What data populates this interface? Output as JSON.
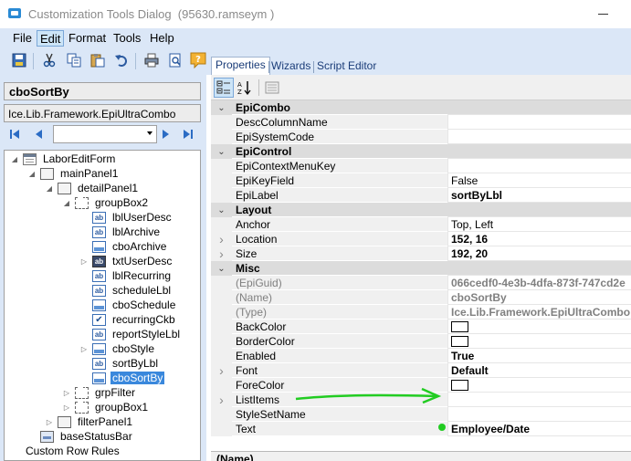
{
  "window": {
    "title": "Customization Tools Dialog",
    "user": "(95630.ramseym )"
  },
  "menu": [
    "File",
    "Edit",
    "Format",
    "Tools",
    "Help"
  ],
  "toolbar_icons": [
    "save-icon",
    "cut-icon",
    "copy-icon",
    "paste-icon",
    "undo-icon",
    "print-icon",
    "print-preview-icon",
    "help-icon"
  ],
  "left": {
    "control_name": "cboSortBy",
    "control_type": "Ice.Lib.Framework.EpiUltraCombo",
    "nav_combo_value": ""
  },
  "tree": [
    {
      "label": "LaborEditForm",
      "icon": "form-icon",
      "depth": 0,
      "expander": "open"
    },
    {
      "label": "mainPanel1",
      "icon": "panel-icon",
      "depth": 1,
      "expander": "open"
    },
    {
      "label": "detailPanel1",
      "icon": "panel-icon",
      "depth": 2,
      "expander": "open"
    },
    {
      "label": "groupBox2",
      "icon": "groupbox-icon",
      "depth": 3,
      "expander": "open"
    },
    {
      "label": "lblUserDesc",
      "icon": "label-icon",
      "depth": 4,
      "expander": ""
    },
    {
      "label": "lblArchive",
      "icon": "label-icon",
      "depth": 4,
      "expander": ""
    },
    {
      "label": "cboArchive",
      "icon": "combo-icon",
      "depth": 4,
      "expander": ""
    },
    {
      "label": "txtUserDesc",
      "icon": "textbox-icon",
      "depth": 4,
      "expander": "closed"
    },
    {
      "label": "lblRecurring",
      "icon": "label-icon",
      "depth": 4,
      "expander": ""
    },
    {
      "label": "scheduleLbl",
      "icon": "label-icon",
      "depth": 4,
      "expander": ""
    },
    {
      "label": "cboSchedule",
      "icon": "combo-icon",
      "depth": 4,
      "expander": ""
    },
    {
      "label": "recurringCkb",
      "icon": "checkbox-icon",
      "depth": 4,
      "expander": ""
    },
    {
      "label": "reportStyleLbl",
      "icon": "label-icon",
      "depth": 4,
      "expander": ""
    },
    {
      "label": "cboStyle",
      "icon": "combo-icon",
      "depth": 4,
      "expander": "closed"
    },
    {
      "label": "sortByLbl",
      "icon": "label-icon",
      "depth": 4,
      "expander": ""
    },
    {
      "label": "cboSortBy",
      "icon": "combo-icon",
      "depth": 4,
      "expander": "",
      "selected": true
    },
    {
      "label": "grpFilter",
      "icon": "groupbox-icon",
      "depth": 3,
      "expander": "closed"
    },
    {
      "label": "groupBox1",
      "icon": "groupbox-icon",
      "depth": 3,
      "expander": "closed"
    },
    {
      "label": "filterPanel1",
      "icon": "panel-icon",
      "depth": 2,
      "expander": "closed"
    },
    {
      "label": "baseStatusBar",
      "icon": "statusbar-icon",
      "depth": 1,
      "expander": ""
    },
    {
      "label": "Custom Row Rules",
      "icon": "",
      "depth": 0,
      "expander": ""
    }
  ],
  "tabs": [
    "Properties",
    "Wizards",
    "Script Editor"
  ],
  "properties": [
    {
      "kind": "category",
      "name": "EpiCombo",
      "expander": "collapse"
    },
    {
      "kind": "prop",
      "name": "DescColumnName",
      "value": ""
    },
    {
      "kind": "prop",
      "name": "EpiSystemCode",
      "value": ""
    },
    {
      "kind": "category",
      "name": "EpiControl",
      "expander": "collapse"
    },
    {
      "kind": "prop",
      "name": "EpiContextMenuKey",
      "value": ""
    },
    {
      "kind": "prop",
      "name": "EpiKeyField",
      "value": "False"
    },
    {
      "kind": "prop",
      "name": "EpiLabel",
      "value": "sortByLbl",
      "bold": true
    },
    {
      "kind": "category",
      "name": "Layout",
      "expander": "collapse"
    },
    {
      "kind": "prop",
      "name": "Anchor",
      "value": "Top, Left"
    },
    {
      "kind": "prop",
      "name": "Location",
      "value": "152, 16",
      "bold": true,
      "expander": "expand"
    },
    {
      "kind": "prop",
      "name": "Size",
      "value": "192, 20",
      "bold": true,
      "expander": "expand"
    },
    {
      "kind": "category",
      "name": "Misc",
      "expander": "collapse"
    },
    {
      "kind": "prop",
      "name": "(EpiGuid)",
      "value": "066cedf0-4e3b-4dfa-873f-747cd2e",
      "gray": true
    },
    {
      "kind": "prop",
      "name": "(Name)",
      "value": "cboSortBy",
      "gray": true
    },
    {
      "kind": "prop",
      "name": "(Type)",
      "value": "Ice.Lib.Framework.EpiUltraCombo",
      "gray": true
    },
    {
      "kind": "prop",
      "name": "BackColor",
      "value": "",
      "color_swatch": true
    },
    {
      "kind": "prop",
      "name": "BorderColor",
      "value": "",
      "color_swatch": true
    },
    {
      "kind": "prop",
      "name": "Enabled",
      "value": "True",
      "bold": true
    },
    {
      "kind": "prop",
      "name": "Font",
      "value": "Default",
      "bold": true,
      "expander": "expand"
    },
    {
      "kind": "prop",
      "name": "ForeColor",
      "value": "",
      "color_swatch": true
    },
    {
      "kind": "prop",
      "name": "ListItems",
      "value": "",
      "expander": "expand"
    },
    {
      "kind": "prop",
      "name": "StyleSetName",
      "value": ""
    },
    {
      "kind": "prop",
      "name": "Text",
      "value": "Employee/Date",
      "bold": true
    }
  ],
  "description_title": "(Name)",
  "colors": {
    "chrome": "#dbe7f7",
    "selection": "#3a88dc",
    "annotation": "#22cc22"
  }
}
